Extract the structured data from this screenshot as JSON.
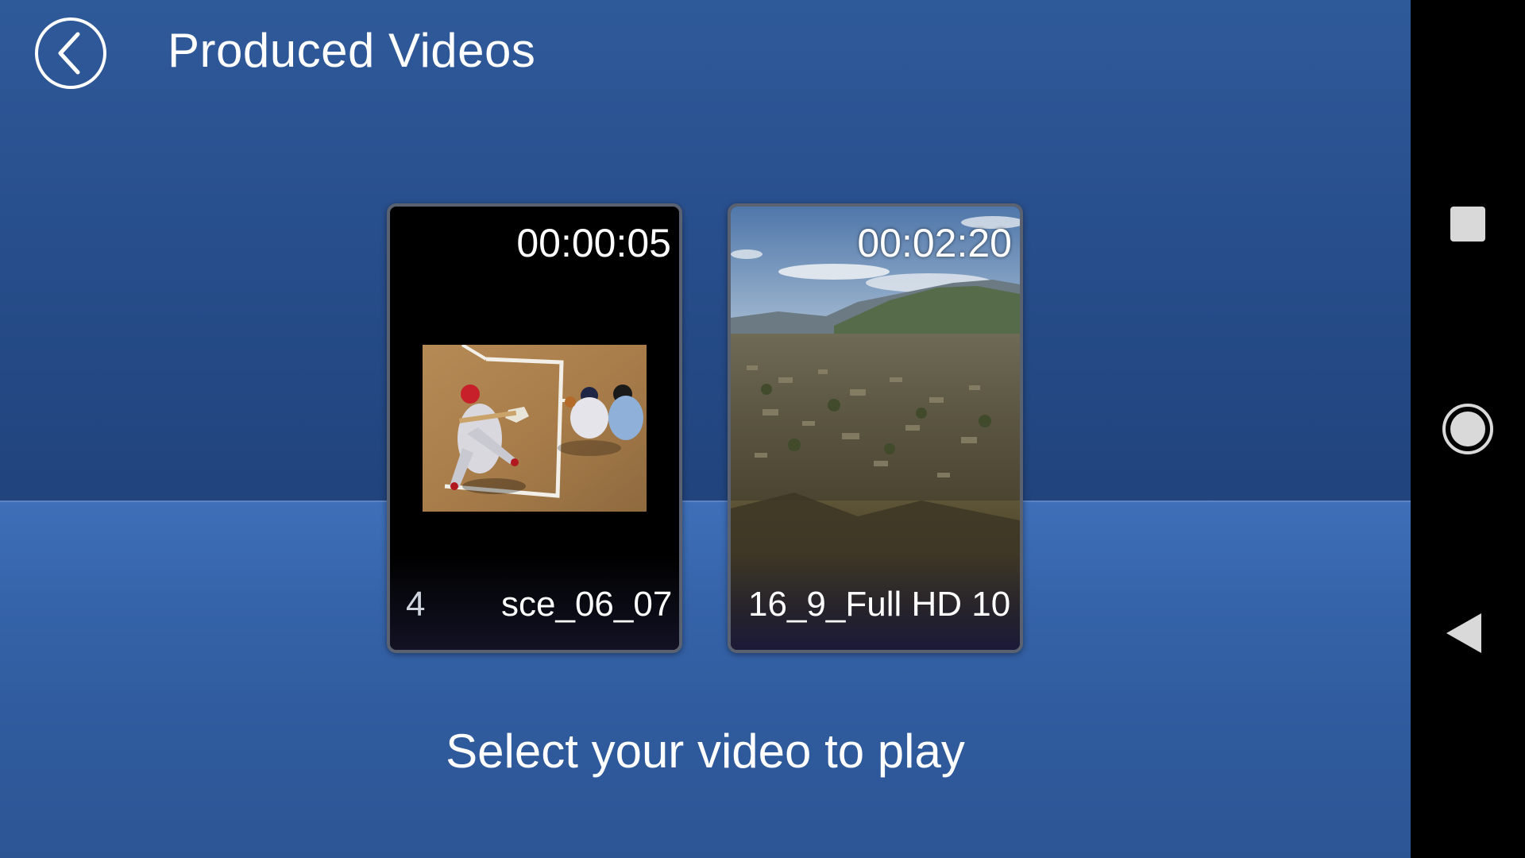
{
  "header": {
    "title": "Produced Videos",
    "back_icon": "chevron-left-icon"
  },
  "videos": [
    {
      "duration": "00:00:05",
      "name_prefix": "4",
      "name": "sce_06_07",
      "thumbnail": "baseball-batter-thumbnail"
    },
    {
      "duration": "00:02:20",
      "name": "16_9_Full HD 10",
      "thumbnail": "mountain-valley-landscape-thumbnail"
    }
  ],
  "prompt": "Select your video to play",
  "navbar": {
    "recent_icon": "square-recent-apps-icon",
    "home_icon": "circle-home-icon",
    "back_icon": "triangle-back-icon"
  },
  "colors": {
    "background_top": "#2f5a9a",
    "floor": "#3e6fb8",
    "navbar": "#000000",
    "text": "#ffffff"
  }
}
